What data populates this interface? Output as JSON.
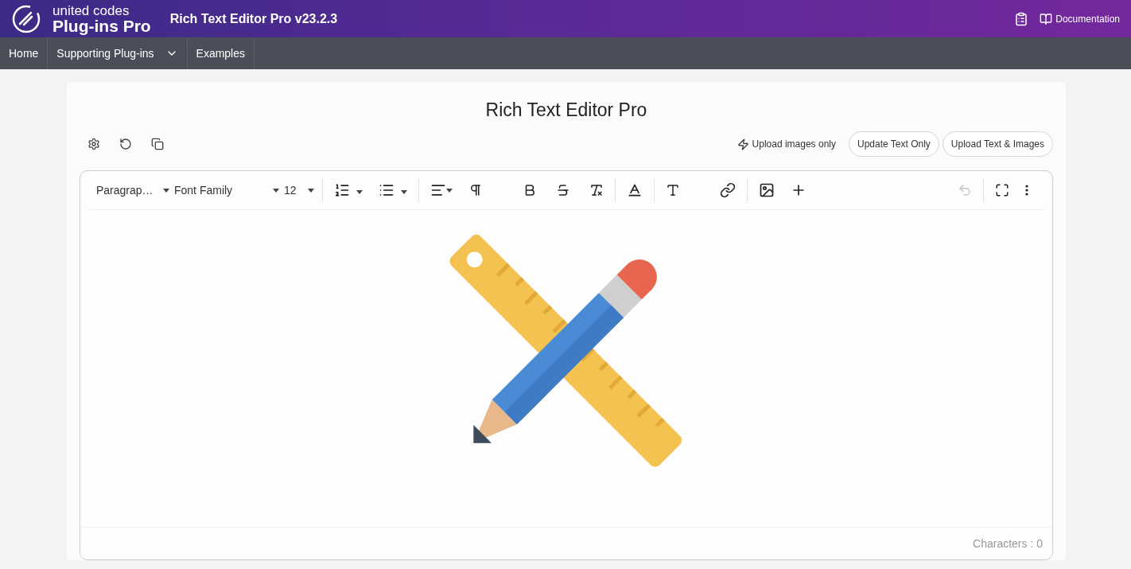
{
  "header": {
    "brand_top": "united codes",
    "brand_bottom": "Plug-ins Pro",
    "title": "Rich Text Editor Pro v23.2.3",
    "documentation": "Documentation"
  },
  "nav": [
    {
      "label": "Home",
      "dropdown": false
    },
    {
      "label": "Supporting Plug-ins",
      "dropdown": true
    },
    {
      "label": "Examples",
      "dropdown": false
    }
  ],
  "page_title": "Rich Text Editor Pro",
  "actions": {
    "upload_images_link": "Upload images only",
    "buttons": [
      "Update Text Only",
      "Upload Text & Images"
    ]
  },
  "editor": {
    "block_format": "Paragrap…",
    "font_family": "Font Family",
    "font_size": "12",
    "undo_disabled": true,
    "status": "Characters : 0"
  }
}
